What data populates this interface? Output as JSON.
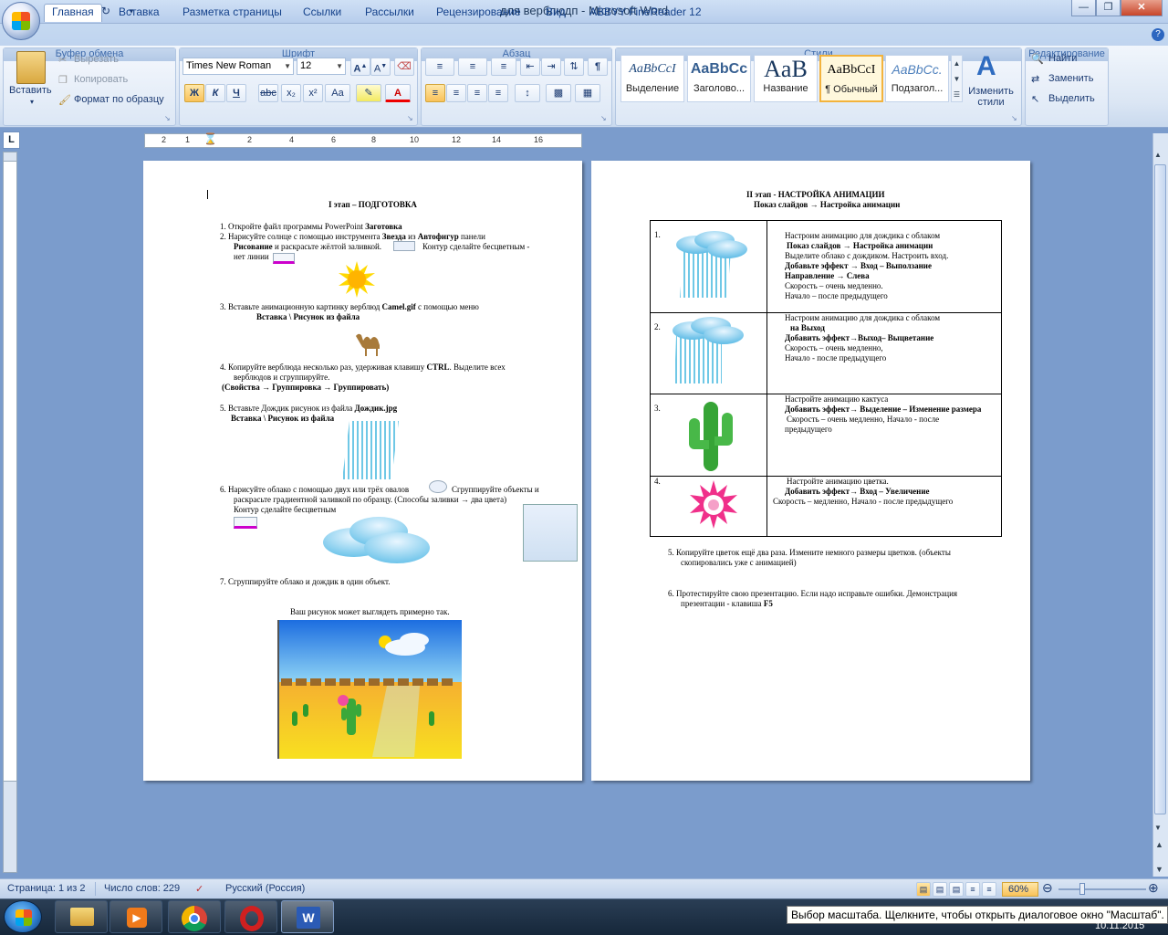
{
  "window": {
    "title": "для верблюдп - Microsoft Word"
  },
  "tabs": [
    "Главная",
    "Вставка",
    "Разметка страницы",
    "Ссылки",
    "Рассылки",
    "Рецензирование",
    "Вид",
    "ABBYY FineReader 12"
  ],
  "clipboard": {
    "paste": "Вставить",
    "cut": "Вырезать",
    "copy": "Копировать",
    "format_painter": "Формат по образцу",
    "label": "Буфер обмена"
  },
  "font": {
    "name": "Times New Roman",
    "size": "12",
    "label": "Шрифт",
    "bold": "Ж",
    "italic": "К",
    "underline": "Ч",
    "strike": "abc",
    "sub": "x₂",
    "sup": "x²",
    "case": "Aa"
  },
  "paragraph": {
    "label": "Абзац"
  },
  "styles": {
    "label": "Стили",
    "items": [
      {
        "preview": "AaBbCcI",
        "name": "Выделение"
      },
      {
        "preview": "AaBbCc",
        "name": "Заголово..."
      },
      {
        "preview": "AaB",
        "name": "Название"
      },
      {
        "preview": "AaBbCcI",
        "name": "¶ Обычный"
      },
      {
        "preview": "AaBbCc.",
        "name": "Подзагол..."
      }
    ],
    "change": "Изменить стили"
  },
  "editing": {
    "find": "Найти",
    "replace": "Заменить",
    "select": "Выделить",
    "label": "Редактирование"
  },
  "ruler_marks": [
    "2",
    "1",
    "2",
    "4",
    "6",
    "8",
    "10",
    "12",
    "14",
    "16"
  ],
  "page1": {
    "title": "I этап – ПОДГОТОВКА",
    "l1": "1.   Откройте файл  программы PowerPoint ",
    "l1b": "Заготовка",
    "l2": "2.   Нарисуйте солнце с помощью инструмента ",
    "l2b": "Звезда",
    "l2c": " из ",
    "l2d": "Автофигур",
    "l2e": " панели",
    "l3b": "Рисование",
    "l3": " и раскрасьте жёлтой заливкой.",
    "l3c": "Контур сделайте бесцветным -",
    "l4": "нет линии",
    "l5": "3.   Вставьте анимационную картинку верблюд  ",
    "l5b": "Camel.gif",
    "l5c": " с помощью меню",
    "l6": "Вставка \\  Рисунок из файла",
    "l7": "4.   Копируйте верблюда несколько раз, удерживая клавишу ",
    "l7b": "CTRL",
    "l7c": ". Выделите всех",
    "l8": "верблюдов и  сгруппируйте.",
    "l9": "(Свойства → Группировка → Группировать)",
    "l10": "5.   Вставьте Дождик рисунок из файла ",
    "l10b": "Дождик.jpg",
    "l11": "Вставка \\   Рисунок из файла",
    "l12": "6.   Нарисуйте облако с помощью двух  или трёх овалов",
    "l12c": "Сгруппируйте объекты и",
    "l13": "раскрасьте градиентной заливкой по образцу. (Способы заливки → два цвета)",
    "l14": "Контур сделайте бесцветным",
    "l15": "7.   Сгруппируйте облако и дождик в один объект.",
    "l16": "Ваш рисунок может выглядеть примерно так."
  },
  "page2": {
    "title1": "II этап  -  НАСТРОЙКА АНИМАЦИИ",
    "title2": "Показ слайдов → Настройка анимации",
    "rows": [
      {
        "num": "1.",
        "lines": [
          "Настроим анимацию  для дождика с облаком",
          "Показ слайдов → Настройка анимации",
          "Выделите облако с дождиком. Настроить вход.",
          "Добавьте эффект → Вход – Выползание",
          "Направление → Слева",
          "Скорость – очень медленно.",
          "Начало – после предыдущего"
        ]
      },
      {
        "num": "2.",
        "lines": [
          "Настроим анимацию  для дождика с облаком",
          "на Выход",
          "Добавить эффект→Выход– Выцветание",
          "Скорость – очень медленно,",
          "Начало - после предыдущего"
        ]
      },
      {
        "num": "3.",
        "lines": [
          "Настройте анимацию кактуса",
          "Добавить эффект→ Выделение – Изменение размера",
          "Скорость – очень медленно, Начало - после",
          "предыдущего"
        ]
      },
      {
        "num": "4.",
        "lines": [
          "Настройте анимацию  цветка.",
          "Добавить эффект→ Вход – Увеличение",
          "Скорость –  медленно, Начало - после предыдущего"
        ]
      }
    ],
    "s5": "5.   Копируйте цветок ещё два раза. Измените  немного размеры цветков. (объекты",
    "s5b": "скопировались уже с анимацией)",
    "s6": "6.   Протестируйте свою презентацию. Если надо исправьте ошибки. Демонстрация",
    "s6b": "презентации - клавиша ",
    "s6c": "F5"
  },
  "status": {
    "page": "Страница: 1 из 2",
    "words": "Число слов: 229",
    "lang": "Русский (Россия)",
    "zoom": "60%"
  },
  "taskbar": {
    "tooltip": "Выбор масштаба. Щелкните, чтобы открыть диалоговое окно \"Масштаб\".",
    "date": "10.11.2015"
  }
}
